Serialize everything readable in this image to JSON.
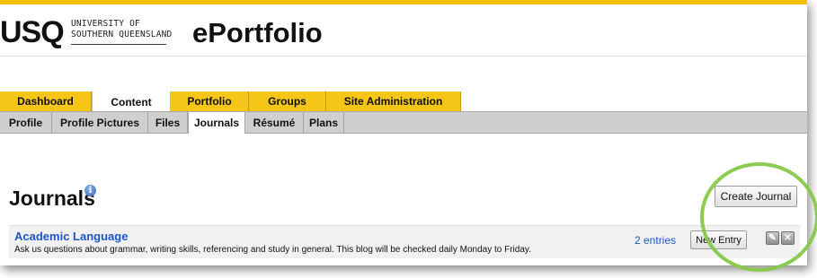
{
  "branding": {
    "mark": "USQ",
    "university_line1": "UNIVERSITY OF",
    "university_line2": "SOUTHERN QUEENSLAND",
    "app_title": "ePortfolio",
    "accent_color": "#f2c200"
  },
  "main_tabs": [
    {
      "label": "Dashboard",
      "active": false
    },
    {
      "label": "Content",
      "active": true
    },
    {
      "label": "Portfolio",
      "active": false
    },
    {
      "label": "Groups",
      "active": false
    },
    {
      "label": "Site Administration",
      "active": false
    }
  ],
  "sub_tabs": [
    {
      "label": "Profile",
      "active": false
    },
    {
      "label": "Profile Pictures",
      "active": false
    },
    {
      "label": "Files",
      "active": false
    },
    {
      "label": "Journals",
      "active": true
    },
    {
      "label": "Résumé",
      "active": false
    },
    {
      "label": "Plans",
      "active": false
    }
  ],
  "page": {
    "heading": "Journals",
    "info_icon": "info-icon",
    "create_button": "Create Journal"
  },
  "journals": [
    {
      "title": "Academic Language",
      "description": "Ask us questions about grammar, writing skills, referencing and study in general. This blog will be checked daily Monday to Friday.",
      "entries_label": "2 entries",
      "new_entry_button": "New Entry",
      "edit_icon": "edit-icon",
      "delete_icon": "delete-icon"
    }
  ],
  "annotation": {
    "ring_color": "#86c94a"
  }
}
